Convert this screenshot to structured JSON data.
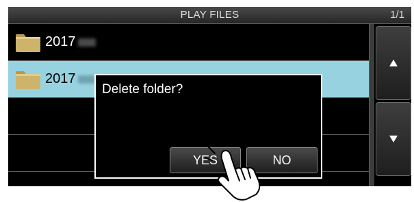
{
  "header": {
    "title": "PLAY FILES",
    "page_count": "1/1"
  },
  "folders": [
    {
      "name": "2017",
      "selected": false
    },
    {
      "name": "2017",
      "selected": true
    }
  ],
  "dialog": {
    "message": "Delete folder?",
    "yes_label": "YES",
    "no_label": "NO"
  },
  "icons": {
    "folder": "folder-icon",
    "scroll_up": "up-arrow-icon",
    "scroll_down": "down-arrow-icon",
    "pointer": "hand-pointer-icon"
  },
  "colors": {
    "selected_row": "#97d2e0",
    "folder": "#cdb36c",
    "background": "#000000"
  }
}
